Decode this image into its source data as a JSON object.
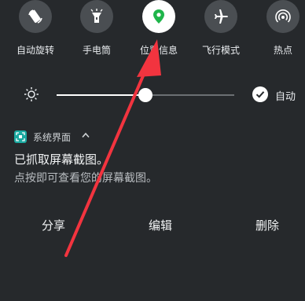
{
  "quick_settings": {
    "tiles": [
      {
        "label": "自动旋转",
        "icon": "auto-rotate-icon",
        "active": false
      },
      {
        "label": "手电筒",
        "icon": "flashlight-icon",
        "active": false
      },
      {
        "label": "位置信息",
        "icon": "location-icon",
        "active": true
      },
      {
        "label": "飞行模式",
        "icon": "airplane-icon",
        "active": false
      },
      {
        "label": "热点",
        "icon": "hotspot-icon",
        "active": false
      }
    ]
  },
  "brightness": {
    "level": 0.5,
    "auto_label": "自动",
    "auto_checked": true
  },
  "notification": {
    "app_name": "系统界面",
    "title": "已抓取屏幕截图。",
    "text": "点按即可查看您的屏幕截图。",
    "actions": {
      "share": "分享",
      "edit": "编辑",
      "delete": "删除"
    }
  },
  "colors": {
    "background": "#26292c",
    "tile": "#4a4e52",
    "tile_active": "#ffffff",
    "location_green": "#1fb54a",
    "app_icon": "#1aa9a0",
    "annotation_arrow": "#f2343f"
  }
}
